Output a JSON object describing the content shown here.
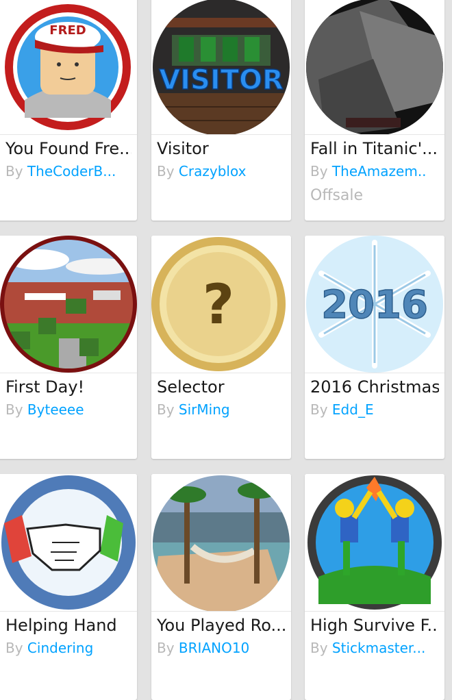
{
  "by_label": "By",
  "items": [
    {
      "name": "You Found Fre...",
      "creator": "TheCoderB...",
      "icon": "fred-avatar-badge-icon"
    },
    {
      "name": "Visitor",
      "creator": "Crazyblox",
      "icon": "visitor-badge-icon"
    },
    {
      "name": "Fall in Titanic'...",
      "creator": "TheAmazem..",
      "status": "Offsale",
      "icon": "titanic-badge-icon"
    },
    {
      "name": "First Day!",
      "creator": "Byteeee",
      "icon": "first-day-badge-icon"
    },
    {
      "name": "Selector",
      "creator": "SirMing",
      "icon": "question-coin-badge-icon"
    },
    {
      "name": "2016 Christmas",
      "creator": "Edd_E",
      "icon": "snowflake-2016-badge-icon"
    },
    {
      "name": "Helping Hand",
      "creator": "Cindering",
      "icon": "handshake-badge-icon"
    },
    {
      "name": "You Played Ro...",
      "creator": "BRIANO10",
      "icon": "beach-hammock-badge-icon"
    },
    {
      "name": "High Survive F...",
      "creator": "Stickmaster...",
      "icon": "high-five-badge-icon"
    }
  ],
  "colors": {
    "creator_link": "#00a2ff",
    "muted": "#b8b8b8",
    "background": "#e3e3e3"
  }
}
